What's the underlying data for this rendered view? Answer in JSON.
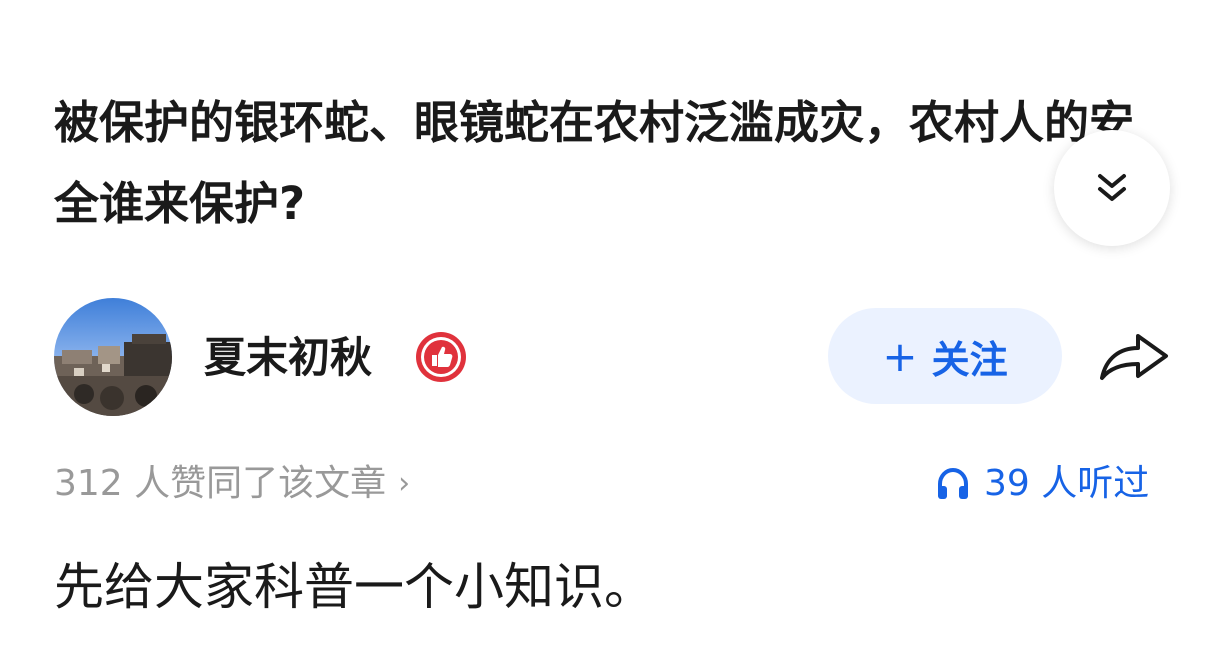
{
  "article": {
    "title": "被保护的银环蛇、眼镜蛇在农村泛滥成灾，农村人的安全谁来保护?",
    "first_paragraph": "先给大家科普一个小知识。"
  },
  "author": {
    "name": "夏末初秋",
    "badge_icon": "thumbs-up-badge-icon"
  },
  "actions": {
    "follow_plus": "+",
    "follow_label": "关注",
    "share_icon": "share-arrow-icon",
    "collapse_icon": "double-chevron-down-icon"
  },
  "stats": {
    "likes_text": "312 人赞同了该文章",
    "likes_chevron": "›",
    "listen_icon": "headphones-icon",
    "listens_text": "39 人听过"
  },
  "colors": {
    "accent": "#1763e6",
    "follow_bg": "#ebf2ff",
    "badge_red": "#e0323c",
    "muted": "#999999"
  }
}
